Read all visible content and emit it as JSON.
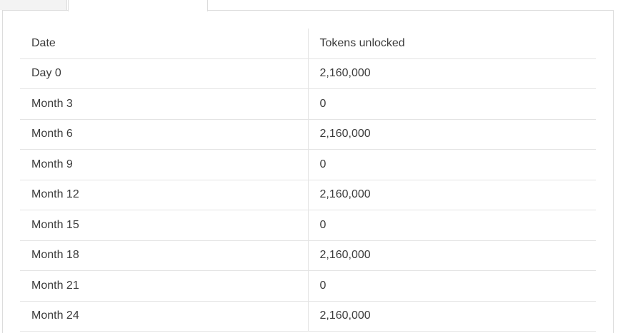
{
  "tabs": [
    {
      "label": ""
    },
    {
      "label": ""
    }
  ],
  "table": {
    "headers": [
      "Date",
      "Tokens unlocked"
    ],
    "rows": [
      [
        "Day 0",
        "2,160,000"
      ],
      [
        "Month 3",
        "0"
      ],
      [
        "Month 6",
        "2,160,000"
      ],
      [
        "Month 9",
        "0"
      ],
      [
        "Month 12",
        "2,160,000"
      ],
      [
        "Month 15",
        "0"
      ],
      [
        "Month 18",
        "2,160,000"
      ],
      [
        "Month 21",
        "0"
      ],
      [
        "Month 24",
        "2,160,000"
      ]
    ]
  }
}
